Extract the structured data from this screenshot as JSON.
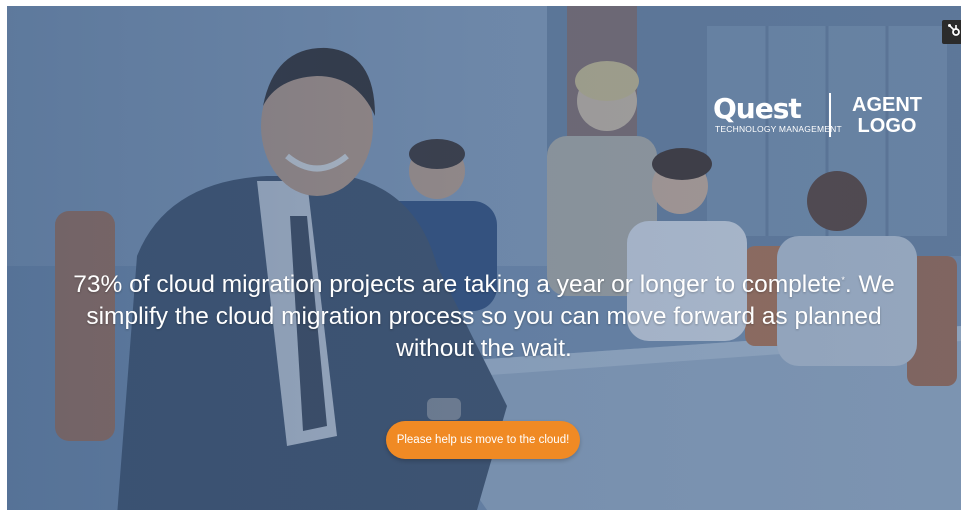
{
  "brand": {
    "primary_logo_text": "Quest",
    "primary_logo_tagline": "TECHNOLOGY MANAGEMENT",
    "partner_logo_line1": "AGENT",
    "partner_logo_line2": "LOGO"
  },
  "hero": {
    "headline_before_note": "73% of cloud migration projects are taking a year or longer to complete",
    "footnote_mark": "*",
    "headline_after_note": ". We simplify the cloud migration process so you can move forward as planned without the wait.",
    "cta_label": "Please help us move to the cloud!"
  },
  "icons": {
    "corner_badge": "hubspot-sprocket-icon"
  },
  "colors": {
    "cta_background": "#f08a24",
    "overlay_tint": "#3c5c87",
    "text": "#ffffff"
  }
}
